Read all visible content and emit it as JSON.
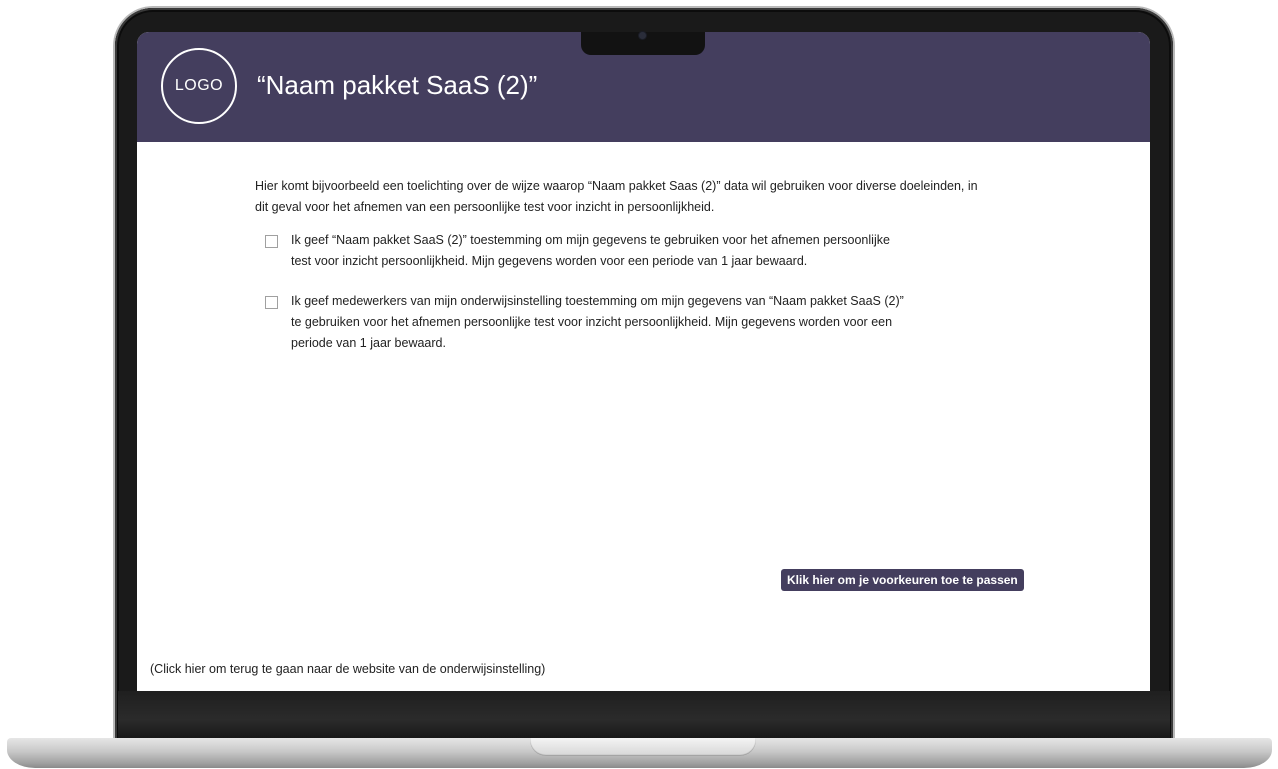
{
  "header": {
    "logo_text": "LOGO",
    "title": "“Naam pakket SaaS (2)”",
    "background_color": "#443e5e"
  },
  "main": {
    "intro_line1": "Hier komt bijvoorbeeld een toelichting over de wijze waarop “Naam pakket Saas (2)” data wil gebruiken voor diverse doeleinden, in",
    "intro_line2": "dit geval voor het afnemen van een persoonlijke test voor inzicht in persoonlijkheid.",
    "consents": [
      {
        "checked": false,
        "line1": "Ik geef “Naam pakket SaaS (2)” toestemming om mijn gegevens te gebruiken voor het afnemen persoonlijke",
        "line2": "test voor inzicht persoonlijkheid. Mijn gegevens worden voor een periode van 1 jaar bewaard.",
        "line3": ""
      },
      {
        "checked": false,
        "line1": "Ik geef medewerkers van mijn onderwijsinstelling toestemming om mijn gegevens van “Naam pakket SaaS (2)”",
        "line2": "te gebruiken voor het afnemen persoonlijke test voor inzicht persoonlijkheid. Mijn gegevens worden voor een",
        "line3": "periode van 1 jaar bewaard."
      }
    ],
    "preferences_button": "Klik hier om je voorkeuren toe te passen"
  },
  "footer": {
    "back_link": "(Click hier om terug te gaan naar de website van de onderwijsinstelling)"
  }
}
